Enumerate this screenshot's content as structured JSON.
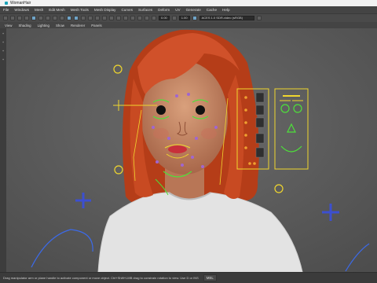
{
  "window": {
    "title": "WomanHair"
  },
  "menubar": {
    "items": [
      "File",
      "Windows",
      "Mesh",
      "Edit Mesh",
      "Mesh Tools",
      "Mesh Display",
      "Curves",
      "Surfaces",
      "Deform",
      "UV",
      "Generate",
      "Cache",
      "Help"
    ]
  },
  "toolbar": {
    "field_a": "0.00",
    "field_b": "1.00",
    "colorspace": "ACES 1.0 SDR-video (sRGB)"
  },
  "panel_menu": {
    "items": [
      "View",
      "Shading",
      "Lighting",
      "Show",
      "Renderer",
      "Panels"
    ]
  },
  "left_dock": {
    "items": [
      "+",
      "+",
      "+",
      "+"
    ]
  },
  "helpline": {
    "message": "Drag manipulator arm or plane handle to activate component or move object. Ctrl+Shift+LMB drag to constrain rotation to view. Use D or INS",
    "language": "MEL"
  },
  "colors": {
    "hair": "#c8461f",
    "control_green": "#4ee03a",
    "control_yellow": "#f0d62e",
    "control_blue": "#3c4fd0",
    "viewport_bg": "#5a5a5a"
  }
}
